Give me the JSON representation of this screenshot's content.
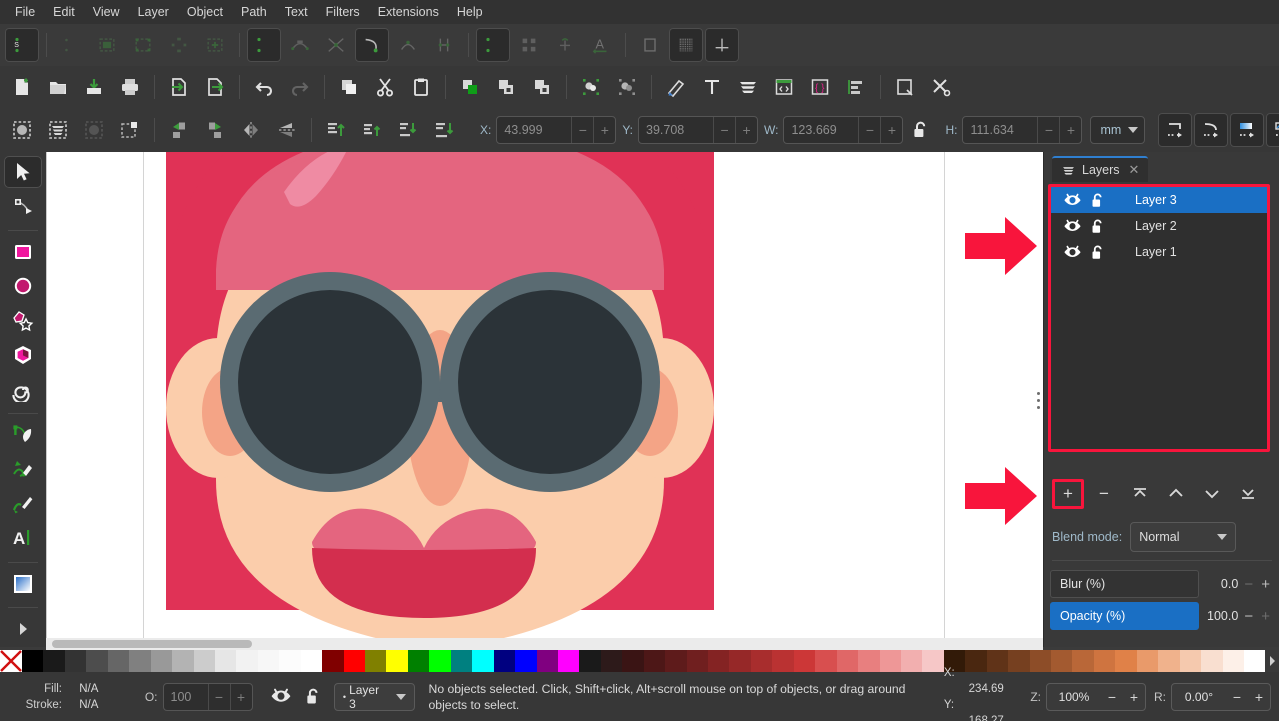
{
  "menu": {
    "items": [
      "File",
      "Edit",
      "View",
      "Layer",
      "Object",
      "Path",
      "Text",
      "Filters",
      "Extensions",
      "Help"
    ]
  },
  "snapbar": {
    "buttons": [
      {
        "name": "snap-enable-global",
        "icon": "magnet-icon",
        "active": false
      },
      {
        "name": "snap-bounding-box",
        "icon": "magnet-bbox-icon",
        "active": false
      },
      {
        "name": "snap-bbox-edge",
        "icon": "bbox-edge-icon",
        "active": false
      },
      {
        "name": "snap-bbox-corner",
        "icon": "bbox-corner-icon",
        "active": false
      },
      {
        "name": "snap-bbox-edge-midpoint",
        "icon": "bbox-midpoint-icon",
        "active": false
      },
      {
        "name": "snap-bbox-center",
        "icon": "bbox-center-icon",
        "active": false
      },
      {
        "name": "snap-nodes-paths",
        "icon": "magnet-node-icon",
        "active": true
      },
      {
        "name": "snap-path",
        "icon": "path-icon",
        "active": false
      },
      {
        "name": "snap-path-intersection",
        "icon": "path-intersection-icon",
        "active": false
      },
      {
        "name": "snap-cusp-node",
        "icon": "cusp-node-icon",
        "active": true
      },
      {
        "name": "snap-smooth-node",
        "icon": "smooth-node-icon",
        "active": false
      },
      {
        "name": "snap-midpoint-line",
        "icon": "line-midpoint-icon",
        "active": false
      },
      {
        "name": "snap-others",
        "icon": "magnet-other-icon",
        "active": true
      },
      {
        "name": "snap-object-center",
        "icon": "object-center-icon",
        "active": false
      },
      {
        "name": "snap-rotation-center",
        "icon": "rotation-center-icon",
        "active": false
      },
      {
        "name": "snap-text-baseline",
        "icon": "text-baseline-icon",
        "active": false
      },
      {
        "name": "snap-page-border",
        "icon": "page-border-icon",
        "active": false
      },
      {
        "name": "snap-grid",
        "icon": "grid-icon",
        "active": true
      },
      {
        "name": "snap-guide",
        "icon": "guide-icon",
        "active": true
      }
    ]
  },
  "commandbar": {
    "buttons": [
      {
        "name": "new-document-button",
        "icon": "new-file-icon"
      },
      {
        "name": "open-document-button",
        "icon": "folder-open-icon"
      },
      {
        "name": "save-document-button",
        "icon": "save-icon"
      },
      {
        "name": "print-document-button",
        "icon": "printer-icon"
      },
      {
        "name": "import-button",
        "icon": "import-icon"
      },
      {
        "name": "export-button",
        "icon": "export-icon"
      },
      {
        "name": "undo-button",
        "icon": "undo-icon"
      },
      {
        "name": "redo-button",
        "icon": "redo-icon"
      },
      {
        "name": "copy-button",
        "icon": "copy-icon"
      },
      {
        "name": "cut-button",
        "icon": "scissors-icon"
      },
      {
        "name": "paste-button",
        "icon": "clipboard-icon"
      },
      {
        "name": "duplicate-button",
        "icon": "duplicate-icon"
      },
      {
        "name": "clone-button",
        "icon": "clone-icon"
      },
      {
        "name": "unlink-clone-button",
        "icon": "unlink-clone-icon"
      },
      {
        "name": "group-button",
        "icon": "group-icon"
      },
      {
        "name": "ungroup-button",
        "icon": "ungroup-icon"
      },
      {
        "name": "fill-and-stroke-button",
        "icon": "paintbrush-icon"
      },
      {
        "name": "text-and-font-button",
        "icon": "text-t-icon"
      },
      {
        "name": "layers-dialog-button",
        "icon": "layers-stack-icon"
      },
      {
        "name": "xml-editor-button",
        "icon": "xml-code-icon"
      },
      {
        "name": "selectors-button",
        "icon": "css-braces-icon"
      },
      {
        "name": "align-and-distribute-button",
        "icon": "align-icon"
      },
      {
        "name": "export-png-button",
        "icon": "export-png-icon"
      },
      {
        "name": "preferences-button",
        "icon": "tools-preferences-icon"
      }
    ]
  },
  "tooloptions": {
    "buttons": [
      {
        "name": "select-all-button",
        "icon": "select-all-icon"
      },
      {
        "name": "select-all-in-all-layers-button",
        "icon": "select-all-layers-icon"
      },
      {
        "name": "deselect-button",
        "icon": "deselect-icon"
      },
      {
        "name": "select-same-button",
        "icon": "select-same-icon"
      },
      {
        "name": "rotate-ccw-button",
        "icon": "rotate-ccw-icon"
      },
      {
        "name": "rotate-cw-button",
        "icon": "rotate-cw-icon"
      },
      {
        "name": "flip-horizontal-button",
        "icon": "flip-horizontal-icon"
      },
      {
        "name": "flip-vertical-button",
        "icon": "flip-vertical-icon"
      },
      {
        "name": "raise-to-top-button",
        "icon": "raise-to-top-icon"
      },
      {
        "name": "raise-button",
        "icon": "raise-icon"
      },
      {
        "name": "lower-button",
        "icon": "lower-icon"
      },
      {
        "name": "lower-to-bottom-button",
        "icon": "lower-to-bottom-icon"
      }
    ],
    "x": {
      "label": "X:",
      "value": "43.999"
    },
    "y": {
      "label": "Y:",
      "value": "39.708"
    },
    "w": {
      "label": "W:",
      "value": "123.669"
    },
    "h": {
      "label": "H:",
      "value": "111.634"
    },
    "lock_icon": "unlocked-padlock-icon",
    "units": "mm",
    "affect_buttons": [
      {
        "name": "affect-stroke-width-button",
        "icon": "scale-stroke-icon"
      },
      {
        "name": "affect-rounded-corners-button",
        "icon": "scale-corners-icon"
      },
      {
        "name": "affect-gradients-button",
        "icon": "scale-gradient-icon"
      },
      {
        "name": "affect-patterns-button",
        "icon": "scale-pattern-icon"
      }
    ]
  },
  "toolbox": {
    "tools": [
      {
        "name": "selector-tool",
        "icon": "arrow-cursor-icon",
        "selected": true
      },
      {
        "name": "node-tool",
        "icon": "node-editor-icon",
        "selected": false
      },
      {
        "name": "rectangle-tool",
        "icon": "square-icon",
        "selected": false
      },
      {
        "name": "ellipse-tool",
        "icon": "circle-icon",
        "selected": false
      },
      {
        "name": "star-tool",
        "icon": "star-icon",
        "selected": false
      },
      {
        "name": "3d-box-tool",
        "icon": "cube-icon",
        "selected": false
      },
      {
        "name": "spiral-tool",
        "icon": "spiral-icon",
        "selected": false
      },
      {
        "name": "bezier-pen-tool",
        "icon": "pen-nib-icon",
        "selected": false
      },
      {
        "name": "pencil-tool",
        "icon": "pencil-icon",
        "selected": false
      },
      {
        "name": "calligraphy-tool",
        "icon": "calligraphy-brush-icon",
        "selected": false
      },
      {
        "name": "text-tool",
        "icon": "text-caret-icon",
        "selected": false
      },
      {
        "name": "gradient-tool",
        "icon": "gradient-square-icon",
        "selected": false
      },
      {
        "name": "more-tools-button",
        "icon": "chevron-right-icon",
        "selected": false
      }
    ]
  },
  "layers_panel": {
    "tab_label": "Layers",
    "tab_icon": "layers-stack-icon",
    "tab_close_icon": "close-icon",
    "rows": [
      {
        "name": "Layer 3",
        "visible": true,
        "locked": false,
        "selected": true,
        "eye_icon": "eye-icon",
        "lock_icon": "unlocked-padlock-icon"
      },
      {
        "name": "Layer 2",
        "visible": true,
        "locked": false,
        "selected": false,
        "eye_icon": "eye-icon",
        "lock_icon": "unlocked-padlock-icon"
      },
      {
        "name": "Layer 1",
        "visible": true,
        "locked": false,
        "selected": false,
        "eye_icon": "eye-icon",
        "lock_icon": "unlocked-padlock-icon"
      }
    ],
    "buttons": [
      {
        "name": "add-layer-button",
        "glyph": "+",
        "highlighted": true
      },
      {
        "name": "delete-layer-button",
        "glyph": "−",
        "highlighted": false
      },
      {
        "name": "layer-to-top-button",
        "glyph": "top",
        "highlighted": false
      },
      {
        "name": "layer-raise-button",
        "glyph": "up",
        "highlighted": false
      },
      {
        "name": "layer-lower-button",
        "glyph": "down",
        "highlighted": false
      },
      {
        "name": "layer-to-bottom-button",
        "glyph": "bottom",
        "highlighted": false
      }
    ],
    "blend_mode": {
      "label": "Blend mode:",
      "value": "Normal"
    },
    "blur": {
      "label": "Blur (%)",
      "value": "0.0",
      "minus": "−",
      "plus": "+"
    },
    "opacity": {
      "label": "Opacity (%)",
      "value": "100.0",
      "minus": "−",
      "plus": "+"
    }
  },
  "annotations": {
    "arrow_color": "#f8153c",
    "arrows": [
      {
        "name": "annotation-arrow-layers-list"
      },
      {
        "name": "annotation-arrow-add-layer"
      }
    ],
    "highlight_color": "#f8153c"
  },
  "artwork": {
    "name": "avatar-illustration",
    "colors": {
      "hair_back": "#e03256",
      "hair_fringe": "#e4657f",
      "hair_highlight": "#ef8ba3",
      "skin": "#fbcdab",
      "ear_inner": "#f4a486",
      "nose": "#f4a486",
      "glasses_frame": "#5a6b72",
      "lens": "#2b3338",
      "lip_top": "#e4657f",
      "lip_bottom": "#d32e4e"
    }
  },
  "palette": {
    "no-color-icon": "no-color-x-icon",
    "swatches": [
      "#000000",
      "#1a1a1a",
      "#333333",
      "#4d4d4d",
      "#666666",
      "#808080",
      "#999999",
      "#b3b3b3",
      "#cccccc",
      "#e6e6e6",
      "#f2f2f2",
      "#f7f7f7",
      "#fcfcfc",
      "#ffffff",
      "#800000",
      "#ff0000",
      "#808000",
      "#ffff00",
      "#008000",
      "#00ff00",
      "#008080",
      "#00ffff",
      "#000080",
      "#0000ff",
      "#800080",
      "#ff00ff",
      "#1a1a1a",
      "#2d1a1a",
      "#3a1414",
      "#4d1717",
      "#5e1b1b",
      "#701f1f",
      "#842323",
      "#962828",
      "#a82d2d",
      "#ba3232",
      "#cc3737",
      "#d84f4f",
      "#e06767",
      "#e87f7f",
      "#ee9797",
      "#f2afaf",
      "#f6c7c7",
      "#321a08",
      "#4a2710",
      "#603318",
      "#764020",
      "#8d4d28",
      "#a35a30",
      "#b96738",
      "#cf7440",
      "#e08148",
      "#e99a6a",
      "#f0b28c",
      "#f5c9ae",
      "#f9dfd0",
      "#fdf0e8",
      "#ffffff"
    ],
    "scroll_icon": "chevron-right-icon"
  },
  "statusbar": {
    "fill_label": "Fill:",
    "fill_value": "N/A",
    "stroke_label": "Stroke:",
    "stroke_value": "N/A",
    "opacity_label": "O:",
    "opacity_value": "100",
    "opacity_minus": "−",
    "opacity_plus": "+",
    "visibility_icon": "eye-icon",
    "lock_icon": "unlocked-padlock-icon",
    "current_layer": "Layer 3",
    "current_layer_caret": "chevron-down-icon",
    "message": "No objects selected. Click, Shift+click, Alt+scroll mouse on top of objects, or drag around objects to select.",
    "pointer_x_label": "X:",
    "pointer_x_value": "234.69",
    "pointer_y_label": "Y:",
    "pointer_y_value": "168.27",
    "zoom_label": "Z:",
    "zoom_value": "100%",
    "zoom_minus": "−",
    "zoom_plus": "+",
    "rotation_label": "R:",
    "rotation_value": "0.00°",
    "rotation_minus": "−",
    "rotation_plus": "+"
  }
}
